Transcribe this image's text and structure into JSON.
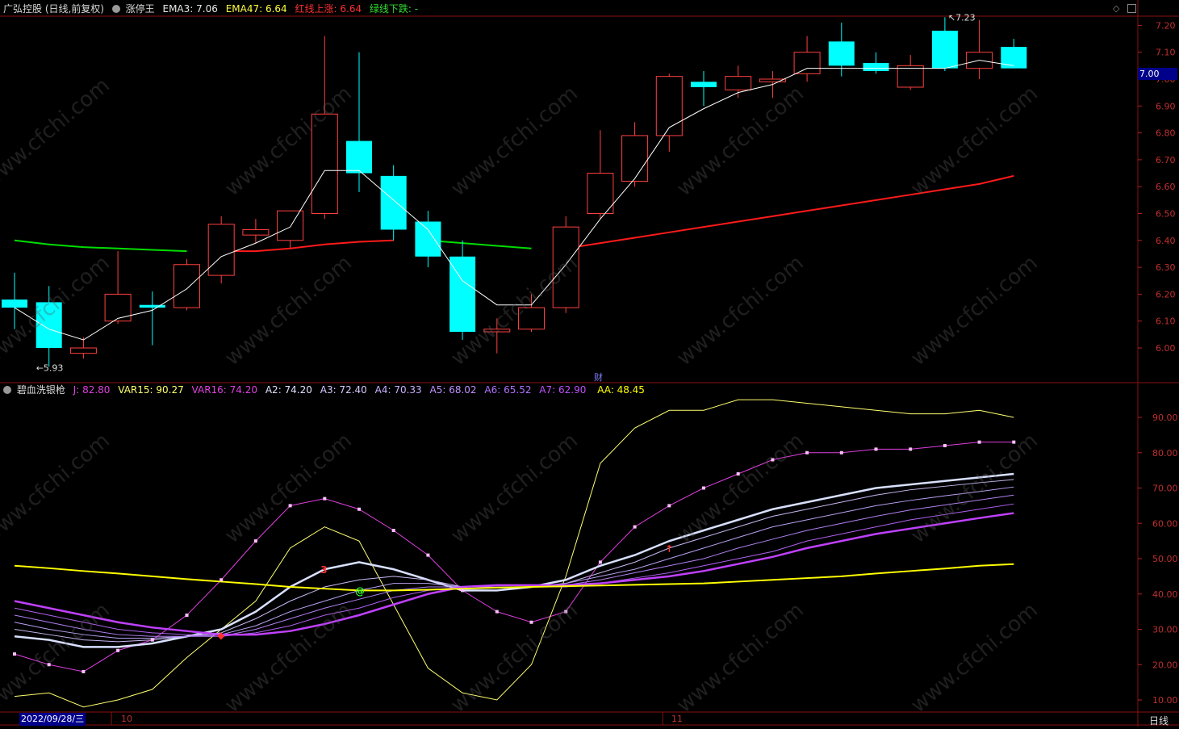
{
  "header_main": {
    "stock": "广弘控股 (日线,前复权)",
    "indicator": "涨停王",
    "ema3_label": "EMA3: 7.06",
    "ema47_label": "EMA47: 6.64",
    "red_label": "红线上涨: 6.64",
    "green_label": "绿线下跌: -"
  },
  "header_sub": {
    "name": "碧血洗银枪",
    "j": "J: 82.80",
    "var15": "VAR15: 90.27",
    "var16": "VAR16: 74.20",
    "a2": "A2: 74.20",
    "a3": "A3: 72.40",
    "a4": "A4: 70.33",
    "a5": "A5: 68.02",
    "a6": "A6: 65.52",
    "a7": "A7: 62.90",
    "aa": "AA: 48.45"
  },
  "current_price_tag": "7.00",
  "max_label": "7.23",
  "min_label": "5.93",
  "cai_marker": "财",
  "bottom_bar": {
    "date_cursor": "2022/09/28/三",
    "month_10": "10",
    "month_11": "11",
    "period_button": "日线"
  },
  "watermark": "www.cfchi.com",
  "colors": {
    "up": "#ff4040",
    "down": "#00ffff",
    "ema3": "#ffffff",
    "red_line": "#ff1a1a",
    "green_line": "#00dd00",
    "j": "#e040e0",
    "var15": "#ffff60",
    "aa": "#ffff00",
    "a_fan": "#c060ff",
    "var16": "#d0d8ff"
  },
  "chart_data": [
    {
      "type": "candlestick",
      "title": "广弘控股 (日线,前复权)",
      "ylim": [
        5.85,
        7.28
      ],
      "yticks": [
        6.0,
        6.1,
        6.2,
        6.3,
        6.4,
        6.5,
        6.6,
        6.7,
        6.8,
        6.9,
        7.0,
        7.1,
        7.2
      ],
      "ytick_labels": [
        "6.00",
        "6.10",
        "6.20",
        "6.30",
        "6.40",
        "6.50",
        "6.60",
        "6.70",
        "6.80",
        "6.90",
        "7.00",
        "7.10",
        "7.20"
      ],
      "candles": [
        {
          "o": 6.18,
          "h": 6.28,
          "l": 6.07,
          "c": 6.15
        },
        {
          "o": 6.17,
          "h": 6.23,
          "l": 5.93,
          "c": 6.0
        },
        {
          "o": 5.98,
          "h": 6.04,
          "l": 5.96,
          "c": 6.0
        },
        {
          "o": 6.1,
          "h": 6.36,
          "l": 6.09,
          "c": 6.2
        },
        {
          "o": 6.16,
          "h": 6.21,
          "l": 6.01,
          "c": 6.15
        },
        {
          "o": 6.15,
          "h": 6.33,
          "l": 6.14,
          "c": 6.31
        },
        {
          "o": 6.27,
          "h": 6.49,
          "l": 6.24,
          "c": 6.46
        },
        {
          "o": 6.42,
          "h": 6.48,
          "l": 6.39,
          "c": 6.44
        },
        {
          "o": 6.4,
          "h": 6.51,
          "l": 6.37,
          "c": 6.51
        },
        {
          "o": 6.5,
          "h": 7.16,
          "l": 6.48,
          "c": 6.87
        },
        {
          "o": 6.77,
          "h": 7.1,
          "l": 6.58,
          "c": 6.65
        },
        {
          "o": 6.64,
          "h": 6.68,
          "l": 6.4,
          "c": 6.44
        },
        {
          "o": 6.47,
          "h": 6.51,
          "l": 6.3,
          "c": 6.34
        },
        {
          "o": 6.34,
          "h": 6.4,
          "l": 6.03,
          "c": 6.06
        },
        {
          "o": 6.06,
          "h": 6.11,
          "l": 5.98,
          "c": 6.07
        },
        {
          "o": 6.07,
          "h": 6.2,
          "l": 6.06,
          "c": 6.15
        },
        {
          "o": 6.15,
          "h": 6.49,
          "l": 6.13,
          "c": 6.45
        },
        {
          "o": 6.5,
          "h": 6.81,
          "l": 6.48,
          "c": 6.65
        },
        {
          "o": 6.62,
          "h": 6.84,
          "l": 6.6,
          "c": 6.79
        },
        {
          "o": 6.79,
          "h": 7.02,
          "l": 6.73,
          "c": 7.01
        },
        {
          "o": 6.99,
          "h": 7.03,
          "l": 6.9,
          "c": 6.97
        },
        {
          "o": 6.96,
          "h": 7.05,
          "l": 6.93,
          "c": 7.01
        },
        {
          "o": 6.99,
          "h": 7.03,
          "l": 6.93,
          "c": 7.0
        },
        {
          "o": 7.02,
          "h": 7.16,
          "l": 6.99,
          "c": 7.1
        },
        {
          "o": 7.14,
          "h": 7.21,
          "l": 7.01,
          "c": 7.05
        },
        {
          "o": 7.06,
          "h": 7.1,
          "l": 7.02,
          "c": 7.03
        },
        {
          "o": 6.97,
          "h": 7.09,
          "l": 6.96,
          "c": 7.05
        },
        {
          "o": 7.18,
          "h": 7.23,
          "l": 7.03,
          "c": 7.04
        },
        {
          "o": 7.04,
          "h": 7.22,
          "l": 7.0,
          "c": 7.1
        },
        {
          "o": 7.12,
          "h": 7.15,
          "l": 7.04,
          "c": 7.04
        }
      ],
      "ema3": [
        6.15,
        6.07,
        6.03,
        6.11,
        6.14,
        6.22,
        6.34,
        6.39,
        6.45,
        6.66,
        6.66,
        6.55,
        6.44,
        6.25,
        6.16,
        6.16,
        6.31,
        6.48,
        6.63,
        6.82,
        6.89,
        6.95,
        6.98,
        7.04,
        7.04,
        7.04,
        7.04,
        7.04,
        7.07,
        7.05
      ],
      "green_segments": [
        {
          "from": 0,
          "to": 5,
          "values": [
            6.4,
            6.385,
            6.375,
            6.37,
            6.365,
            6.36
          ]
        },
        {
          "from": 12,
          "to": 15,
          "values": [
            6.4,
            6.39,
            6.38,
            6.37
          ]
        }
      ],
      "red_segments": [
        {
          "from": 6,
          "to": 11,
          "values": [
            6.36,
            6.36,
            6.37,
            6.385,
            6.395,
            6.4
          ]
        },
        {
          "from": 16,
          "to": 29,
          "values": [
            6.37,
            6.39,
            6.41,
            6.43,
            6.45,
            6.47,
            6.49,
            6.51,
            6.53,
            6.55,
            6.57,
            6.59,
            6.61,
            6.64
          ]
        }
      ]
    },
    {
      "type": "line",
      "title": "碧血洗银枪",
      "ylim": [
        8,
        97
      ],
      "yticks": [
        10,
        20,
        30,
        40,
        50,
        60,
        70,
        80,
        90
      ],
      "ytick_labels": [
        "10.00",
        "20.00",
        "30.00",
        "40.00",
        "50.00",
        "60.00",
        "70.00",
        "80.00",
        "90.00"
      ],
      "series": [
        {
          "name": "J",
          "values": [
            23,
            20,
            18,
            24,
            27,
            34,
            44,
            55,
            65,
            67,
            64,
            58,
            51,
            41,
            35,
            32,
            35,
            49,
            59,
            65,
            70,
            74,
            78,
            80,
            80,
            81,
            81,
            82,
            83,
            83
          ]
        },
        {
          "name": "VAR15",
          "values": [
            11,
            12,
            8,
            10,
            13,
            22,
            30,
            38,
            53,
            59,
            55,
            37,
            19,
            12,
            10,
            20,
            45,
            77,
            87,
            92,
            92,
            95,
            95,
            94,
            93,
            92,
            91,
            91,
            92,
            90
          ]
        },
        {
          "name": "VAR16",
          "values": [
            28,
            27,
            25,
            25,
            26,
            28,
            30,
            35,
            42,
            47,
            49,
            47,
            44,
            41,
            41,
            42,
            44,
            48,
            51,
            55,
            58,
            61,
            64,
            66,
            68,
            70,
            71,
            72,
            73,
            74
          ]
        },
        {
          "name": "A2",
          "values": [
            30,
            28.5,
            27,
            26.5,
            27,
            28,
            29,
            33,
            38,
            42,
            44,
            45,
            44,
            42,
            42,
            42,
            43,
            46,
            49,
            53,
            56,
            59,
            62,
            64,
            66,
            68,
            69.5,
            70.5,
            71.5,
            72.4
          ]
        },
        {
          "name": "A3",
          "values": [
            32,
            30,
            28.5,
            27.5,
            27.5,
            28,
            28.5,
            31,
            35,
            38,
            41,
            43,
            43,
            42,
            42,
            42,
            43,
            45,
            47,
            50,
            53,
            56,
            59,
            61,
            63,
            65,
            66.5,
            67.8,
            69,
            70.3
          ]
        },
        {
          "name": "A4",
          "values": [
            34,
            32,
            30,
            28.5,
            28,
            28,
            28,
            30,
            33,
            36,
            38.5,
            41,
            42,
            42,
            42,
            42,
            42.5,
            44,
            46,
            48,
            50,
            53,
            55.5,
            58,
            60,
            62,
            63.8,
            65.2,
            66.6,
            68.0
          ]
        },
        {
          "name": "A5",
          "values": [
            36,
            34,
            32,
            30,
            29,
            28.5,
            28,
            29,
            31,
            34,
            36,
            39,
            41,
            42,
            42,
            42,
            42,
            43,
            44.5,
            46,
            48,
            50,
            52,
            55,
            57,
            59,
            61,
            62.5,
            64,
            65.5
          ]
        },
        {
          "name": "A6",
          "values": [
            38,
            36,
            34,
            32,
            30.5,
            29.5,
            28.5,
            28.5,
            29.5,
            31.5,
            34,
            37,
            40,
            42,
            42.5,
            42.5,
            42.5,
            43,
            44,
            45,
            46.5,
            48.5,
            50.5,
            53,
            55,
            57,
            58.5,
            60,
            61.5,
            62.9
          ]
        },
        {
          "name": "AA",
          "values": [
            48,
            47.3,
            46.5,
            45.8,
            45,
            44.2,
            43.5,
            42.8,
            42,
            41.5,
            41,
            41,
            41.2,
            41.5,
            41.8,
            42,
            42.2,
            42.4,
            42.6,
            42.8,
            43,
            43.5,
            44,
            44.5,
            45,
            45.8,
            46.5,
            47.2,
            48,
            48.45
          ]
        }
      ],
      "markers": [
        {
          "index": 6,
          "text": "◆",
          "series": "A6"
        },
        {
          "index": 9,
          "text": "3",
          "series": "VAR16"
        },
        {
          "index": 10,
          "text": "@",
          "series": "AA"
        },
        {
          "index": 19,
          "text": "↑",
          "series": "A2"
        }
      ]
    }
  ]
}
